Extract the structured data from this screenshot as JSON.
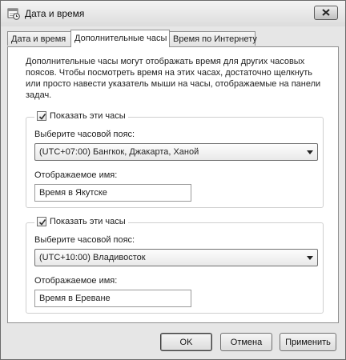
{
  "window": {
    "title": "Дата и время",
    "icon": "calendar-clock-icon"
  },
  "tabs": [
    {
      "label": "Дата и время",
      "active": false
    },
    {
      "label": "Дополнительные часы",
      "active": true
    },
    {
      "label": "Время по Интернету",
      "active": false
    }
  ],
  "description": "Дополнительные часы могут отображать время для других часовых поясов. Чтобы посмотреть время на этих часах, достаточно щелкнуть или просто навести указатель мыши на часы, отображаемые на панели задач.",
  "clocks": [
    {
      "show_label": "Показать эти часы",
      "checked": true,
      "timezone_label": "Выберите часовой пояс:",
      "timezone_value": "(UTC+07:00) Бангкок, Джакарта, Ханой",
      "name_label": "Отображаемое имя:",
      "name_value": "Время в Якутске"
    },
    {
      "show_label": "Показать эти часы",
      "checked": true,
      "timezone_label": "Выберите часовой пояс:",
      "timezone_value": "(UTC+10:00) Владивосток",
      "name_label": "Отображаемое имя:",
      "name_value": "Время в Ереване"
    }
  ],
  "buttons": {
    "ok": "OK",
    "cancel": "Отмена",
    "apply": "Применить"
  }
}
